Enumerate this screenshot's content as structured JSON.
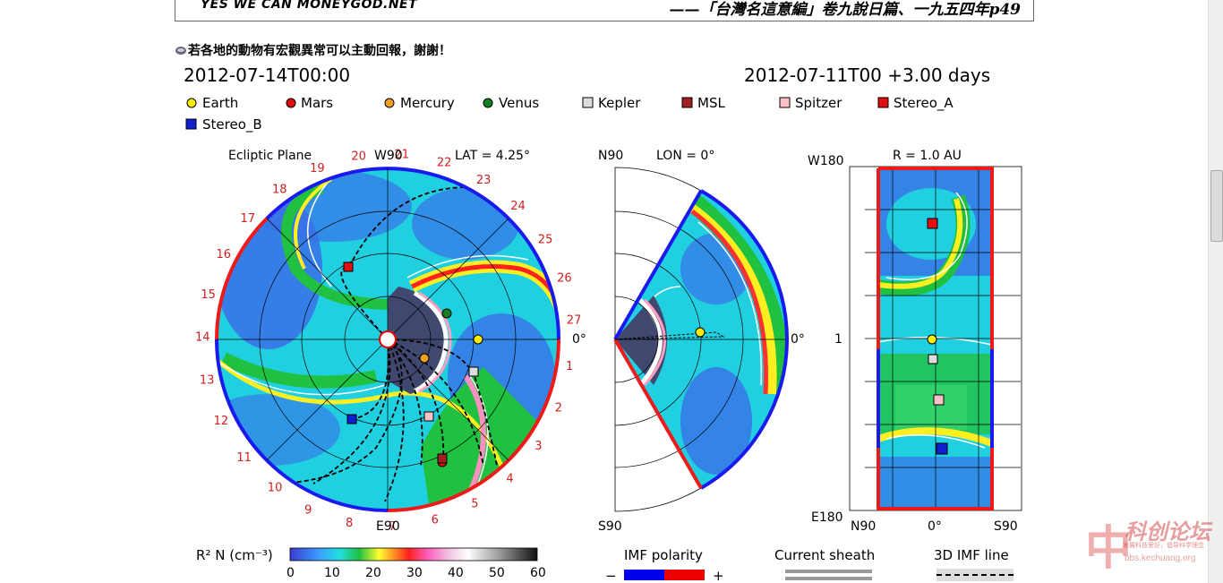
{
  "banner": {
    "left_text": "YES WE CAN MONEYGOD.NET",
    "right_text": "——「台灣名這意編」卷九說日篇、一九五四年p49"
  },
  "notice": {
    "text": "若各地的動物有宏觀異常可以主動回報，謝謝！"
  },
  "plot": {
    "time_label": "2012-07-14T00:00",
    "run_label": "2012-07-11T00 +3.00 days",
    "legend": [
      {
        "label": "Earth",
        "color": "#ffee00",
        "shape": "circle"
      },
      {
        "label": "Mars",
        "color": "#e01010",
        "shape": "circle"
      },
      {
        "label": "Mercury",
        "color": "#f0a020",
        "shape": "circle"
      },
      {
        "label": "Venus",
        "color": "#108020",
        "shape": "circle"
      },
      {
        "label": "Kepler",
        "color": "#dddddd",
        "shape": "square"
      },
      {
        "label": "MSL",
        "color": "#a02020",
        "shape": "square"
      },
      {
        "label": "Spitzer",
        "color": "#ffc0c8",
        "shape": "square"
      },
      {
        "label": "Stereo_A",
        "color": "#e01010",
        "shape": "square"
      },
      {
        "label": "Stereo_B",
        "color": "#1020d0",
        "shape": "square"
      }
    ],
    "ecliptic": {
      "title": "Ecliptic Plane",
      "top_label": "W90",
      "bottom_label": "E90",
      "right_label": "0°",
      "lat_label": "LAT = 4.25°",
      "rotations": [
        "1",
        "2",
        "3",
        "4",
        "5",
        "6",
        "7",
        "8",
        "9",
        "10",
        "11",
        "12",
        "13",
        "14",
        "15",
        "16",
        "17",
        "18",
        "19",
        "20",
        "21",
        "22",
        "23",
        "24",
        "25",
        "26",
        "27"
      ]
    },
    "meridional": {
      "lon_label": "LON = 0°",
      "top_label": "N90",
      "bottom_label": "S90",
      "right_label": "0°"
    },
    "radial": {
      "r_label": "R = 1.0 AU",
      "top_left": "W180",
      "bottom_left": "E180",
      "mid_left": "1",
      "bottom_labels": [
        "N90",
        "0°",
        "S90"
      ]
    },
    "colorbar": {
      "title": "R² N (cm⁻³)",
      "ticks": [
        "0",
        "10",
        "20",
        "30",
        "40",
        "50",
        "60"
      ]
    },
    "imf": {
      "title": "IMF polarity",
      "minus": "−",
      "plus": "+"
    },
    "sheath": {
      "title": "Current sheath"
    },
    "imfline": {
      "title": "3D IMF line"
    }
  },
  "watermark": {
    "logo": "中",
    "title": "科创论坛",
    "slogan": "发展科技爱好，倡导科学理念",
    "url": "bbs.kechuang.org"
  },
  "colors": {
    "imf_negative": "#0000ee",
    "imf_positive": "#ee0000"
  }
}
